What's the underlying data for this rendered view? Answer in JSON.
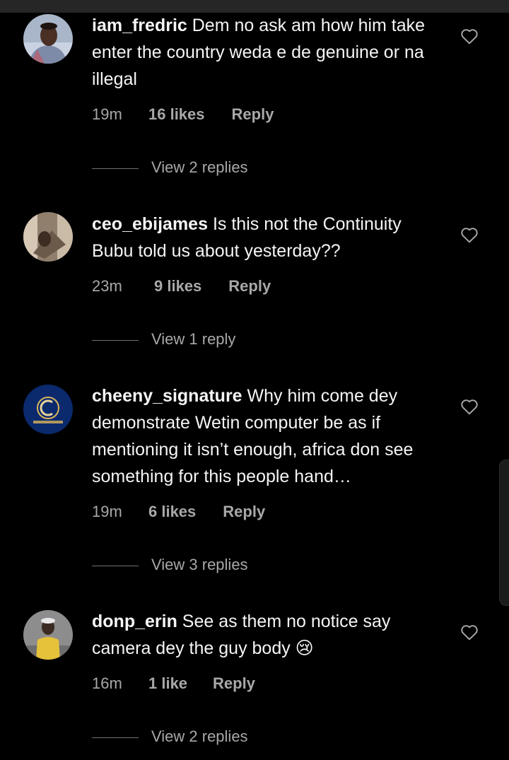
{
  "comments": [
    {
      "username": "iam_fredric",
      "text": "Dem no ask am how him take enter the country weda e de genuine or na illegal",
      "time": "19m",
      "likes": "16 likes",
      "reply": "Reply",
      "view_replies": "View 2 replies"
    },
    {
      "username": "ceo_ebijames",
      "text": "Is this not the Continuity Bubu told us about yesterday??",
      "time": "23m",
      "likes": "9 likes",
      "reply": "Reply",
      "view_replies": "View 1 reply"
    },
    {
      "username": "cheeny_signature",
      "text": "Why him come dey demonstrate Wetin computer be as if mentioning it isn’t enough, africa don see something for this people hand…",
      "time": "19m",
      "likes": "6 likes",
      "reply": "Reply",
      "view_replies": "View 3 replies"
    },
    {
      "username": "donp_erin",
      "text": "See as them no notice say camera dey the guy body 😢",
      "time": "16m",
      "likes": "1 like",
      "reply": "Reply",
      "view_replies": "View 2 replies"
    }
  ],
  "icons": {
    "like": "heart-outline-icon"
  },
  "colors": {
    "background": "#000000",
    "text_primary": "#f5f5f5",
    "text_secondary": "#a8a8a8"
  }
}
